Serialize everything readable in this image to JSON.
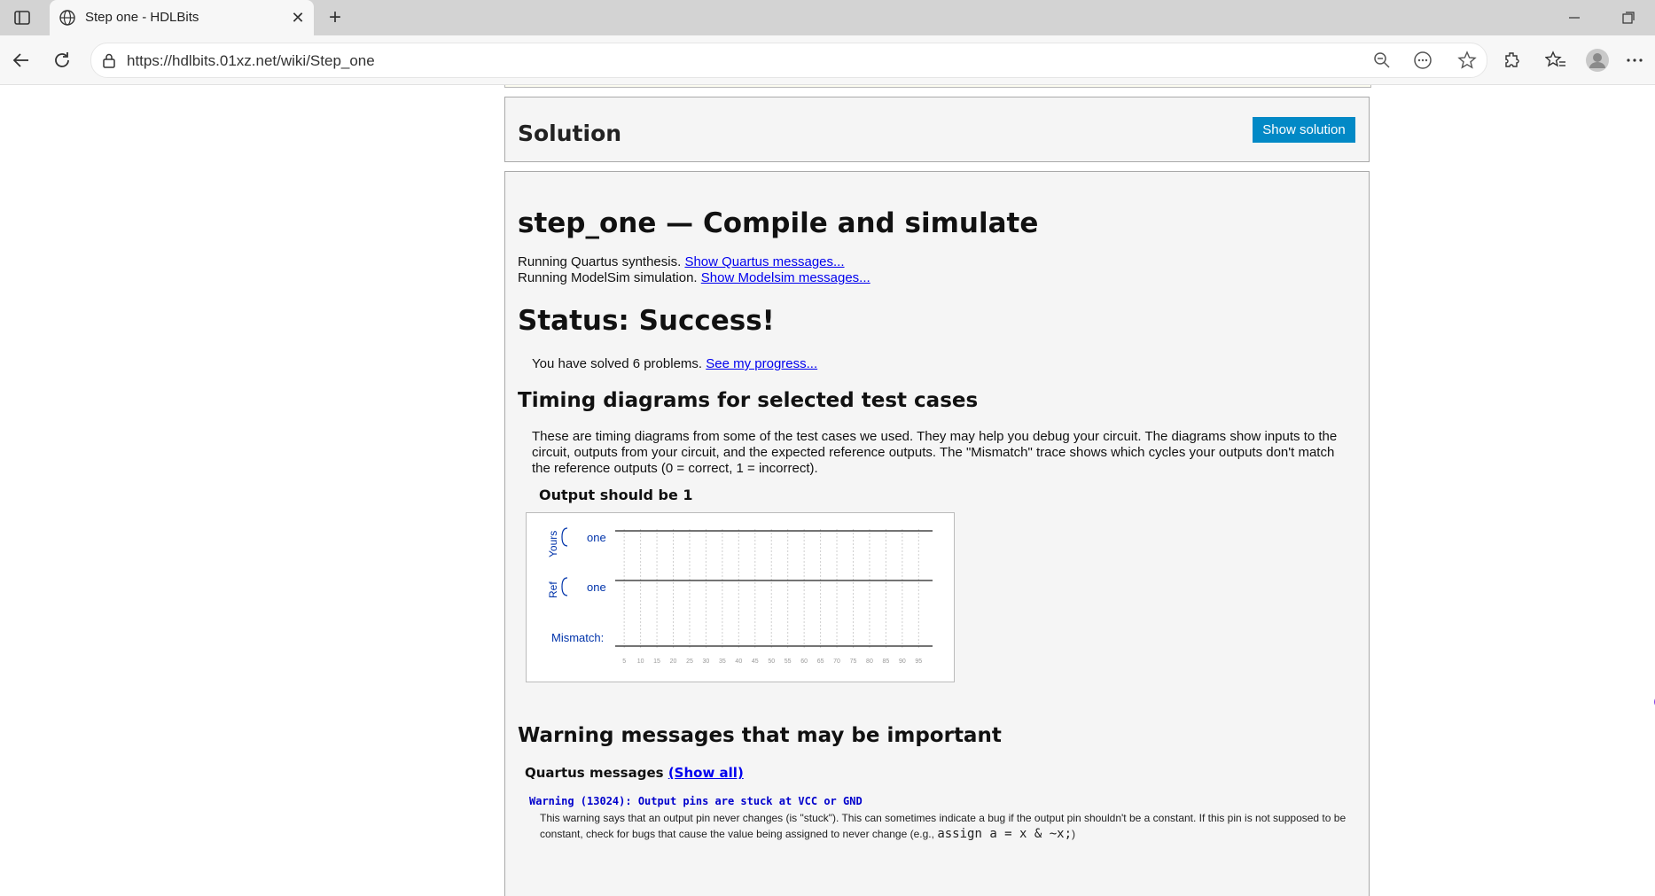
{
  "browser": {
    "tab_title": "Step one - HDLBits",
    "url": "https://hdlbits.01xz.net/wiki/Step_one",
    "icons": [
      "sidebar-icon",
      "globe-icon",
      "close-icon",
      "plus-icon",
      "minimize-icon",
      "restore-icon",
      "back-icon",
      "refresh-icon",
      "lock-icon",
      "zoom-out-icon",
      "reader-icon",
      "star-icon",
      "extensions-icon",
      "favorites-icon",
      "profile-icon",
      "more-icon"
    ]
  },
  "solution": {
    "title": "Solution",
    "button_label": "Show solution"
  },
  "result": {
    "title": "step_one — Compile and simulate",
    "quartus_prefix": "Running Quartus synthesis.",
    "quartus_link": "Show Quartus messages...",
    "modelsim_prefix": "Running ModelSim simulation.",
    "modelsim_link": "Show Modelsim messages...",
    "status_title": "Status: Success!",
    "solved_prefix": "You have solved 6 problems.",
    "progress_link": "See my progress...",
    "timing_title": "Timing diagrams for selected test cases",
    "timing_desc": "These are timing diagrams from some of the test cases we used. They may help you debug your circuit. The diagrams show inputs to the circuit, outputs from your circuit, and the expected reference outputs. The \"Mismatch\" trace shows which cycles your outputs don't match the reference outputs (0 = correct, 1 = incorrect).",
    "case_title": "Output should be 1"
  },
  "waveform": {
    "group_yours": "Yours",
    "group_ref": "Ref",
    "signal_yours": "one",
    "signal_ref": "one",
    "mismatch_label": "Mismatch:",
    "ticks": [
      "5",
      "10",
      "15",
      "20",
      "25",
      "30",
      "35",
      "40",
      "45",
      "50",
      "55",
      "60",
      "65",
      "70",
      "75",
      "80",
      "85",
      "90",
      "95"
    ],
    "yours_value": 1,
    "ref_value": 1,
    "mismatch_value": 0,
    "label_color": "#0033aa"
  },
  "warnings": {
    "title": "Warning messages that may be important",
    "quartus_label": "Quartus messages",
    "show_all": "(Show all)",
    "code": "Warning (13024): Output pins are stuck at VCC or GND",
    "text_before": "This warning says that an output pin never changes (is \"stuck\"). This can sometimes indicate a bug if the output pin shouldn't be a constant. If this pin is not supposed to be constant, check for bugs that cause the value being assigned to never change (e.g.,",
    "code_example": "assign a = x & ~x;",
    "text_after": ")"
  }
}
